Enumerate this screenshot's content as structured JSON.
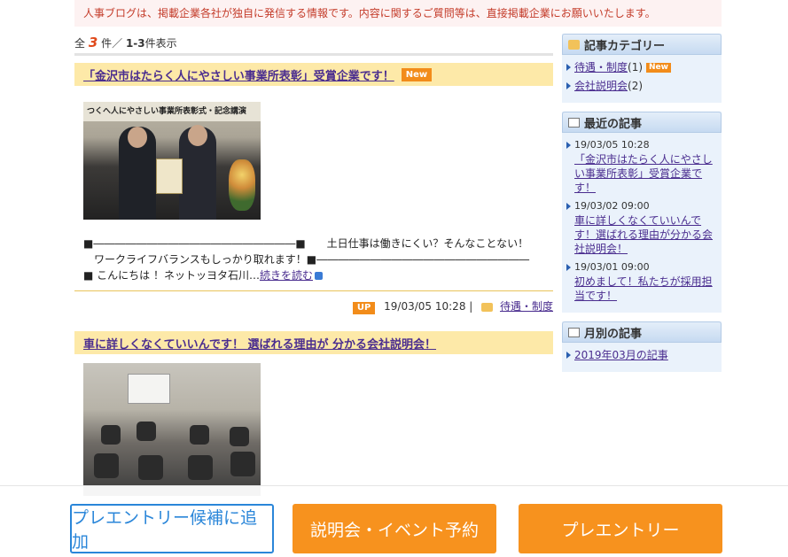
{
  "notice": "人事ブログは、掲載企業各社が独自に発信する情報です。内容に関するご質問等は、直接掲載企業にお願いいたします。",
  "count": {
    "prefix": "全",
    "total": "3",
    "unit": "件／",
    "range": "1-3",
    "range_suffix": "件表示"
  },
  "posts": [
    {
      "title": "「金沢市はたらく人にやさしい事業所表彰」受賞企業です！",
      "badge": "New",
      "photo_banner": "つくへ人にやさしい事業所表彰式・記念講演",
      "excerpt_lines": [
        "■―――――――――――――――――――■　　土日仕事は働きにくい？そんなことない！",
        "　ワークライフバランスもしっかり取れます！■――――――――――――――――――――",
        "■ こんにちは ！ネットッヨタ石川…"
      ],
      "more_link": "続きを読む",
      "up_badge": "UP",
      "datetime": "19/03/05 10:28",
      "category": "待遇・制度"
    },
    {
      "title": "車に詳しくなくていいんです！ 選ばれる理由が 分かる会社説明会！"
    }
  ],
  "sidebar": {
    "categories": {
      "title": "記事カテゴリー",
      "items": [
        {
          "label": "待遇・制度",
          "count": "(1)",
          "badge": "New"
        },
        {
          "label": "会社説明会",
          "count": "(2)"
        }
      ]
    },
    "recent": {
      "title": "最近の記事",
      "items": [
        {
          "date": "19/03/05 10:28",
          "label": "「金沢市はたらく人にやさしい事業所表彰」受賞企業です！"
        },
        {
          "date": "19/03/02 09:00",
          "label": "車に詳しくなくていいんです！選ばれる理由が分かる会社説明会！"
        },
        {
          "date": "19/03/01 09:00",
          "label": "初めまして！私たちが採用担当です！"
        }
      ]
    },
    "monthly": {
      "title": "月別の記事",
      "items": [
        {
          "label": "2019年03月の記事"
        }
      ]
    }
  },
  "bottom": {
    "add_candidate": "プレエントリー候補に追加",
    "event_reserve": "説明会・イベント予約",
    "pre_entry": "プレエントリー"
  },
  "colors": {
    "accent_orange": "#f7921e",
    "link_purple": "#4a2d8f",
    "brand_blue": "#2a86d9",
    "title_bg": "#fde9a8"
  }
}
